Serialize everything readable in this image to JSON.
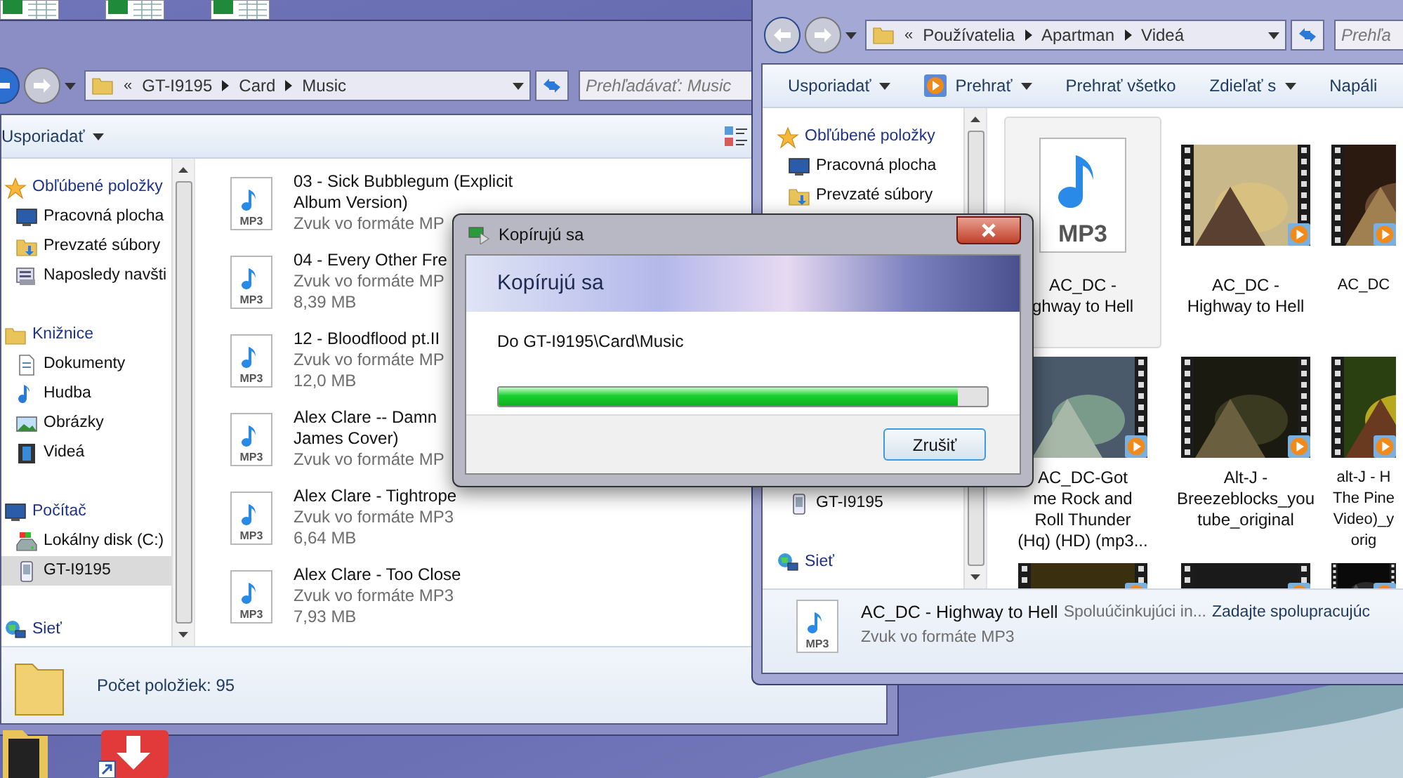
{
  "left_window": {
    "address": {
      "overflow": "«",
      "segments": [
        "GT-I9195",
        "Card",
        "Music"
      ]
    },
    "search": {
      "placeholder": "Prehľadávať: Music"
    },
    "toolbar": [
      "Usporiadať"
    ],
    "sidebar_sections": [
      {
        "groups": [
          {
            "label": "Obľúbené položky",
            "kind": "favorites",
            "selected": false,
            "children": [
              {
                "label": "Pracovná plocha",
                "kind": "desktop",
                "selected": false
              },
              {
                "label": "Prevzaté súbory",
                "kind": "downloads",
                "selected": false
              },
              {
                "label": "Naposledy navšti",
                "kind": "recent",
                "selected": false
              }
            ]
          },
          {
            "label": "Knižnice",
            "kind": "library",
            "selected": false,
            "children": [
              {
                "label": "Dokumenty",
                "kind": "documents",
                "selected": false
              },
              {
                "label": "Hudba",
                "kind": "music",
                "selected": false
              },
              {
                "label": "Obrázky",
                "kind": "pictures",
                "selected": false
              },
              {
                "label": "Videá",
                "kind": "videos",
                "selected": false
              }
            ]
          },
          {
            "label": "Počítač",
            "kind": "computer",
            "selected": false,
            "children": [
              {
                "label": "Lokálny disk (C:)",
                "kind": "disk",
                "selected": false
              },
              {
                "label": "GT-I9195",
                "kind": "phone",
                "selected": true
              }
            ]
          },
          {
            "label": "Sieť",
            "kind": "network",
            "selected": false
          }
        ]
      }
    ],
    "files": [
      {
        "name_lines": [
          "03 - Sick Bubblegum (Explicit",
          "Album Version)"
        ],
        "type": "Zvuk vo formáte MP",
        "icon_label": "MP3"
      },
      {
        "name_lines": [
          "04 - Every Other Fre"
        ],
        "type": "Zvuk vo formáte MP",
        "size": "8,39 MB",
        "icon_label": "MP3"
      },
      {
        "name_lines": [
          "12 - Bloodflood pt.II"
        ],
        "type": "Zvuk vo formáte MP",
        "size": "12,0 MB",
        "icon_label": "MP3"
      },
      {
        "name_lines": [
          "Alex Clare -- Damn",
          "James Cover)"
        ],
        "type": "Zvuk vo formáte MP",
        "icon_label": "MP3"
      },
      {
        "name_lines": [
          "Alex Clare - Tightrope"
        ],
        "type": "Zvuk vo formáte MP3",
        "size": "6,64 MB",
        "icon_label": "MP3"
      },
      {
        "name_lines": [
          "Alex Clare - Too Close"
        ],
        "type": "Zvuk vo formáte MP3",
        "size": "7,93 MB",
        "icon_label": "MP3"
      }
    ],
    "details": {
      "text": "Počet položiek: 95"
    }
  },
  "right_window": {
    "address": {
      "overflow": "«",
      "segments": [
        "Používatelia",
        "Apartman",
        "Videá"
      ]
    },
    "search": {
      "placeholder": "Prehľa"
    },
    "toolbar": [
      {
        "label": "Usporiadať",
        "kind": "menu"
      },
      {
        "label": "Prehrať",
        "kind": "play"
      },
      {
        "label": "Prehrať všetko",
        "kind": "plain"
      },
      {
        "label": "Zdieľať s",
        "kind": "menu"
      },
      {
        "label": "Napáli",
        "kind": "plain"
      }
    ],
    "sidebar_sections": [
      {
        "groups": [
          {
            "label": "Obľúbené položky",
            "kind": "favorites",
            "selected": false,
            "children": [
              {
                "label": "Pracovná plocha",
                "kind": "desktop",
                "selected": false
              },
              {
                "label": "Prevzaté súbory",
                "kind": "downloads",
                "selected": false
              }
            ]
          }
        ]
      },
      {
        "groups": [
          {
            "children": [
              {
                "label": "GT-I9195",
                "kind": "phone",
                "selected": false
              }
            ]
          },
          {
            "label": "Sieť",
            "kind": "network",
            "selected": false
          }
        ]
      }
    ],
    "tiles": [
      {
        "kind": "audio",
        "icon_label": "MP3",
        "label_lines": [
          "AC_DC -",
          "ghway to Hell"
        ],
        "selected": true
      },
      {
        "kind": "video",
        "label_lines": [
          "AC_DC -",
          "Highway to Hell"
        ],
        "selected": false
      },
      {
        "kind": "video",
        "label_lines": [
          "AC_DC"
        ],
        "selected": false
      },
      {
        "kind": "video",
        "label_lines": [
          "AC_DC-Got",
          "me Rock and",
          "Roll Thunder",
          "(Hq) (HD) (mp3..."
        ],
        "selected": false
      },
      {
        "kind": "video",
        "label_lines": [
          "Alt-J -",
          "Breezeblocks_you",
          "tube_original"
        ],
        "selected": false
      },
      {
        "kind": "video",
        "label_lines": [
          "alt-J - H",
          "The Pine",
          "Video)_y",
          "orig"
        ],
        "selected": false
      },
      {
        "kind": "video",
        "selected": false
      },
      {
        "kind": "video",
        "selected": false
      },
      {
        "kind": "video",
        "selected": false
      }
    ],
    "details": {
      "title": "AC_DC - Highway to Hell",
      "fields": [
        "Spoluúčinkujúci in...",
        "Zadajte spolupracujúc"
      ],
      "type": "Zvuk vo formáte MP3",
      "icon_label": "MP3"
    }
  },
  "dialog": {
    "title": "Kopírujú sa",
    "heading": "Kopírujú sa",
    "destination": "Do GT-I9195\\Card\\Music",
    "progress": {
      "level": 0.94
    },
    "buttons": [
      "Zrušiť"
    ]
  }
}
